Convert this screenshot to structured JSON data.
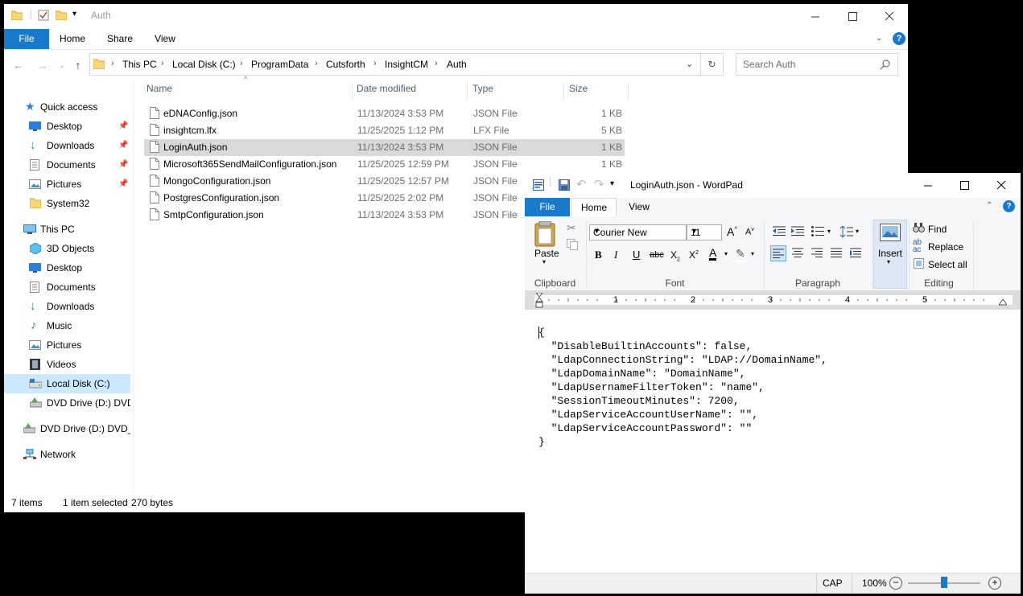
{
  "explorer": {
    "title": "Auth",
    "tabs": [
      "File",
      "Home",
      "Share",
      "View"
    ],
    "breadcrumb": [
      "This PC",
      "Local Disk (C:)",
      "ProgramData",
      "Cutsforth",
      "InsightCM",
      "Auth"
    ],
    "search_placeholder": "Search Auth",
    "nav": {
      "quick_access": "Quick access",
      "quick_items": [
        "Desktop",
        "Downloads",
        "Documents",
        "Pictures",
        "System32"
      ],
      "this_pc": "This PC",
      "pc_items": [
        "3D Objects",
        "Desktop",
        "Documents",
        "Downloads",
        "Music",
        "Pictures",
        "Videos",
        "Local Disk (C:)",
        "DVD Drive (D:) DVD_"
      ],
      "dvd_root": "DVD Drive (D:) DVD_R",
      "network": "Network"
    },
    "columns": {
      "name": "Name",
      "date": "Date modified",
      "type": "Type",
      "size": "Size"
    },
    "files": [
      {
        "name": "eDNAConfig.json",
        "date": "11/13/2024 3:53 PM",
        "type": "JSON File",
        "size": "1 KB"
      },
      {
        "name": "insightcm.lfx",
        "date": "11/25/2025 1:12 PM",
        "type": "LFX File",
        "size": "5 KB"
      },
      {
        "name": "LoginAuth.json",
        "date": "11/13/2024 3:53 PM",
        "type": "JSON File",
        "size": "1 KB"
      },
      {
        "name": "Microsoft365SendMailConfiguration.json",
        "date": "11/25/2025 12:59 PM",
        "type": "JSON File",
        "size": "1 KB"
      },
      {
        "name": "MongoConfiguration.json",
        "date": "11/25/2025 12:57 PM",
        "type": "JSON File",
        "size": ""
      },
      {
        "name": "PostgresConfiguration.json",
        "date": "11/25/2025 2:02 PM",
        "type": "JSON File",
        "size": ""
      },
      {
        "name": "SmtpConfiguration.json",
        "date": "11/13/2024 3:53 PM",
        "type": "JSON File",
        "size": ""
      }
    ],
    "selected_index": 2,
    "status": {
      "items": "7 items",
      "selected": "1 item selected",
      "bytes": "270 bytes"
    }
  },
  "wordpad": {
    "title": "LoginAuth.json - WordPad",
    "tabs": [
      "File",
      "Home",
      "View"
    ],
    "clipboard": {
      "paste": "Paste",
      "label": "Clipboard"
    },
    "font": {
      "family": "Courier New",
      "size": "11",
      "label": "Font"
    },
    "paragraph": {
      "label": "Paragraph"
    },
    "insert": {
      "label": "Insert"
    },
    "editing": {
      "find": "Find",
      "replace": "Replace",
      "select_all": "Select all",
      "label": "Editing"
    },
    "ruler_numbers": [
      "1",
      "2",
      "3",
      "4",
      "5"
    ],
    "document": [
      "{",
      "  \"DisableBuiltinAccounts\": false,",
      "  \"LdapConnectionString\": \"LDAP://DomainName\",",
      "  \"LdapDomainName\": \"DomainName\",",
      "  \"LdapUsernameFilterToken\": \"name\",",
      "  \"SessionTimeoutMinutes\": 7200,",
      "  \"LdapServiceAccountUserName\": \"\",",
      "  \"LdapServiceAccountPassword\": \"\"",
      "}"
    ],
    "status": {
      "caps": "CAP",
      "zoom": "100%"
    },
    "zoom_fraction": 0.5
  },
  "colors": {
    "accent": "#1979ca",
    "folder": "#f8d775",
    "selection": "#cce8ff"
  }
}
